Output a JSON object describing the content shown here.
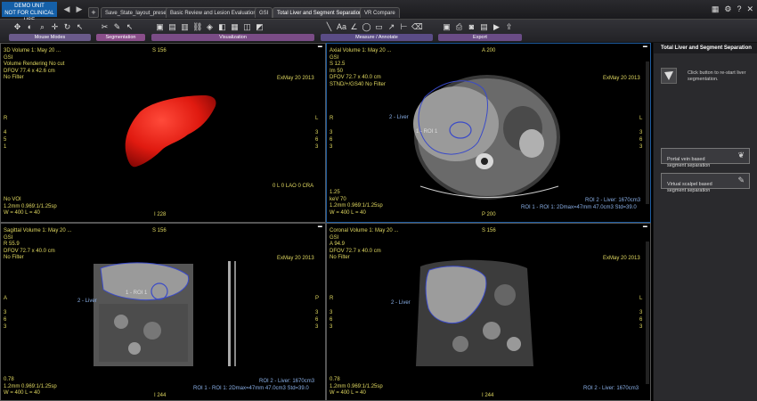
{
  "app": {
    "demo_badge": "DEMO UNIT\nNOT FOR CLINICAL USE",
    "tabs": [
      "Save_State_layout_preset",
      "Basic Review and Lesion Evaluation",
      "GSI",
      "Total Liver and Segment Separation",
      "VR Compare"
    ],
    "plus": "+"
  },
  "toolbar": {
    "groups": [
      "Mouse Modes",
      "Segmentation",
      "Visualization",
      "Measure / Annotate",
      "Export"
    ]
  },
  "panel": {
    "title": "Total Liver and Segment Separation",
    "restart_text": "Click button to re-start liver segmentation.",
    "portal_btn": "Portal vein based\nsegment separation",
    "virtual_btn": "Virtual scalpel based\nsegment separation"
  },
  "vp3d": {
    "tl": "3D Volume 1: May 20 ...\nGSI\nVolume Rendering No cut\nDFOV 77.4 x 42.6 cm\nNo Filter",
    "top": "S 156",
    "tr": "ExMay 20 2013",
    "left": "R\n\n4\n5\n1",
    "right": "L\n\n3\n6\n3",
    "bl": "No VOI\n1.2mm 0.969:1/1.25sp\nW = 400 L = 40",
    "br": "0 L 0 LAO 0 CRA",
    "bottom": "I 228"
  },
  "vpaxial": {
    "tl": "Axial Volume 1: May 20 ...\nGSI\nS 12.5\nIm 50\nDFOV 72.7 x 40.0 cm\nSTND/+/GS40 No Filter",
    "top": "A 200",
    "tr": "ExMay 20 2013",
    "left": "R\n\n3\n6\n3",
    "right": "L\n\n3\n6\n3",
    "roi1": "1 - ROI 1",
    "liver": "2 - Liver",
    "bl": "1.25\nkeV 70\n1.2mm 0.969:1/1.25sp\nW = 400 L = 40",
    "br1": "ROI 2 - Liver: 1670cm3",
    "br2": "ROI 1 - ROI 1: 2Dmax=47mm 47.0cm3 Std=39.0",
    "bottom": "P 200"
  },
  "vpsag": {
    "tl": "Sagittal Volume 1: May 20 ...\nGSI\nR 55.9\nDFOV 72.7 x 40.0 cm\nNo Filter",
    "top": "S 156",
    "tr": "ExMay 20 2013",
    "left": "A\n\n3\n6\n3",
    "right": "P\n\n3\n6\n3",
    "liver": "2 - Liver",
    "roi1": "1 - ROI 1",
    "bl": "0.78\n1.2mm 0.969:1/1.25sp\nW = 400 L = 40",
    "br1": "ROI 2 - Liver: 1670cm3",
    "br2": "ROI 1 - ROI 1: 2Dmax=47mm 47.0cm3 Std=39.0",
    "bottom": "I 244"
  },
  "vpcor": {
    "tl": "Coronal Volume 1: May 20 ...\nGSI\nA 94.9\nDFOV 72.7 x 40.0 cm\nNo Filter",
    "top": "S 156",
    "tr": "ExMay 20 2013",
    "left": "R\n\n3\n6\n3",
    "right": "L\n\n3\n6\n3",
    "liver": "2 - Liver",
    "bl": "0.78\n1.2mm 0.969:1/1.25sp\nW = 400 L = 40",
    "br": "ROI 2 - Liver: 1670cm3",
    "bottom": "I 244"
  }
}
